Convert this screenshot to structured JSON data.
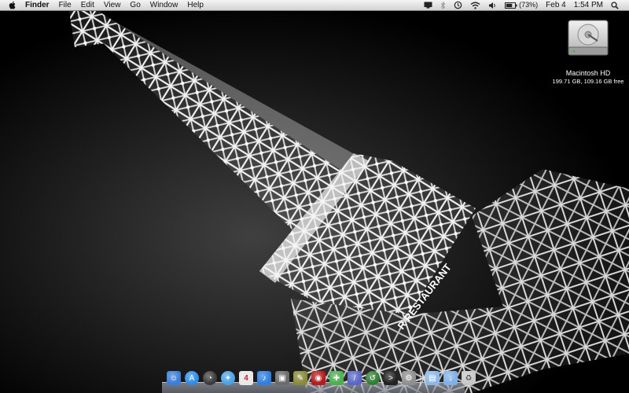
{
  "menubar": {
    "apple_icon": "apple-icon",
    "app_name": "Finder",
    "menus": [
      "File",
      "Edit",
      "View",
      "Go",
      "Window",
      "Help"
    ],
    "status": {
      "battery_percent": "(73%)",
      "date": "Feb 4",
      "time": "1:54 PM"
    }
  },
  "desktop": {
    "drive_name": "Macintosh HD",
    "drive_info": "199.71 GB, 109.16 GB free"
  },
  "wallpaper": {
    "sign_text": "R RESTAURANT"
  },
  "dock": {
    "items": [
      {
        "name": "finder-icon",
        "color": "#3b7ed8"
      },
      {
        "name": "app-store-icon",
        "color": "#2d8ee8"
      },
      {
        "name": "dashboard-icon",
        "color": "#3b3b3b"
      },
      {
        "name": "safari-icon",
        "color": "#4aa3e8"
      },
      {
        "name": "ical-icon",
        "color": "#e8e8e8"
      },
      {
        "name": "itunes-icon",
        "color": "#2f7fe0"
      },
      {
        "name": "iphoto-icon",
        "color": "#6b6b6b"
      },
      {
        "name": "tool-icon",
        "color": "#8a8a3a"
      },
      {
        "name": "photo-booth-icon",
        "color": "#b71c1c"
      },
      {
        "name": "green-app-icon",
        "color": "#4caf50"
      },
      {
        "name": "pen-app-icon",
        "color": "#5a67c8"
      },
      {
        "name": "time-machine-icon",
        "color": "#2e7d32"
      },
      {
        "name": "terminal-icon",
        "color": "#222222"
      },
      {
        "name": "system-preferences-icon",
        "color": "#8f8f8f"
      },
      {
        "name": "documents-folder-icon",
        "color": "#8cb7e8"
      },
      {
        "name": "downloads-folder-icon",
        "color": "#7fb0e6"
      },
      {
        "name": "trash-icon",
        "color": "#c8c8c8"
      }
    ]
  }
}
